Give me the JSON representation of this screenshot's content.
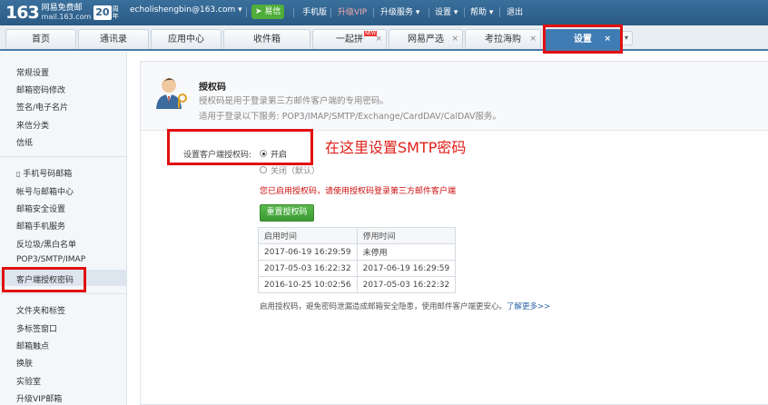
{
  "topbar": {
    "logo_number": "163",
    "logo_cn": "网易免费邮",
    "logo_domain": "mail.163.com",
    "logo_badge": "20",
    "logo_badge_suffix": "周年",
    "account": "echolishengbin@163.com",
    "account_caret": "▾",
    "yixin": "易信",
    "mobile": "手机版",
    "vip": "升级VIP",
    "upgrade_service": "升级服务",
    "settings": "设置",
    "help": "帮助",
    "logout": "退出",
    "caret": "▾"
  },
  "tabs": [
    {
      "label": "首页"
    },
    {
      "label": "通讯录"
    },
    {
      "label": "应用中心"
    },
    {
      "label": "收件箱"
    },
    {
      "label": "一起拼",
      "badge": "NEW",
      "closable": "×"
    },
    {
      "label": "网易严选",
      "closable": "×"
    },
    {
      "label": "考拉海购",
      "closable": "×"
    },
    {
      "label": "设置",
      "closable": "×",
      "active": true
    }
  ],
  "tab_more": "▾",
  "sidebar": {
    "items": [
      {
        "label": "常规设置"
      },
      {
        "label": "邮箱密码修改"
      },
      {
        "label": "签名/电子名片"
      },
      {
        "label": "来信分类"
      },
      {
        "label": "信纸"
      },
      {
        "label": "手机号码邮箱"
      },
      {
        "label": "帐号与邮箱中心"
      },
      {
        "label": "邮箱安全设置"
      },
      {
        "label": "邮箱手机服务"
      },
      {
        "label": "反垃圾/黑白名单"
      },
      {
        "label": "POP3/SMTP/IMAP"
      },
      {
        "label": "客户端授权密码",
        "active": true
      },
      {
        "label": "文件夹和标签"
      },
      {
        "label": "多标签窗口"
      },
      {
        "label": "邮箱触点"
      },
      {
        "label": "换肤"
      },
      {
        "label": "实验室"
      },
      {
        "label": "升级VIP邮箱"
      }
    ]
  },
  "auth": {
    "title": "授权码",
    "desc1": "授权码是用于登录第三方邮件客户端的专用密码。",
    "desc2": "适用于登录以下服务: POP3/IMAP/SMTP/Exchange/CardDAV/CalDAV服务。"
  },
  "setting": {
    "label": "设置客户端授权码:",
    "option_on": "开启",
    "option_off": "关闭（默认）",
    "selected": "开启",
    "annotation": "在这里设置SMTP密码",
    "warning": "您已启用授权码，请使用授权码登录第三方邮件客户端",
    "reset_button": "重置授权码"
  },
  "log_table": {
    "headers": [
      "启用时间",
      "停用时间"
    ],
    "rows": [
      [
        "2017-06-19 16:29:59",
        "未停用"
      ],
      [
        "2017-05-03 16:22:32",
        "2017-06-19 16:29:59"
      ],
      [
        "2016-10-25 10:02:56",
        "2017-05-03 16:22:32"
      ]
    ]
  },
  "footer": {
    "note": "启用授权码，避免密码泄漏造成邮箱安全隐患，使用邮件客户端更安心。",
    "link": "了解更多>>"
  },
  "colors": {
    "topbar": "#2d5f8a",
    "active_tab": "#3f7cb3",
    "highlight_box": "#e0100f",
    "reset_button": "#4aa83e"
  }
}
